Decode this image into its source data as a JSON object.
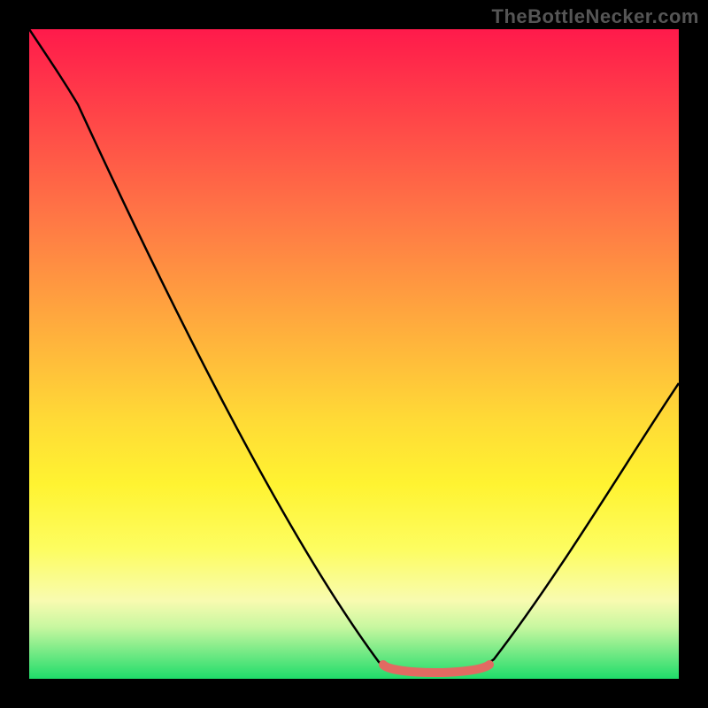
{
  "watermark": "TheBottleNecker.com",
  "colors": {
    "frame_bg": "#000000",
    "gradient_top": "#ff1a4b",
    "gradient_bottom": "#1fdc6a",
    "curve_stroke": "#000000",
    "marker_stroke": "#e26a62",
    "watermark_text": "#555555"
  },
  "chart_data": {
    "type": "line",
    "title": "",
    "xlabel": "",
    "ylabel": "",
    "xlim": [
      0,
      100
    ],
    "ylim": [
      0,
      100
    ],
    "grid": false,
    "legend": false,
    "x": [
      0,
      5,
      10,
      15,
      20,
      25,
      30,
      35,
      40,
      45,
      50,
      55,
      60,
      65,
      70,
      75,
      80,
      85,
      90,
      95,
      100
    ],
    "values": [
      100,
      92,
      86,
      78,
      70,
      62,
      54,
      46,
      38,
      29,
      20,
      10,
      4,
      1,
      1,
      4,
      12,
      22,
      32,
      40,
      46
    ],
    "highlight_region": {
      "x_start": 55,
      "x_end": 72,
      "note": "flat minimum band near bottom, drawn in muted red"
    },
    "description": "A single smooth V-shaped curve descending from the top-left corner to a broad minimum around x≈60–70 then rising toward the right edge, overlaid on a vertical rainbow heat gradient (red at top through yellow to green at bottom). No axes, ticks, or labels are rendered. A short red-orange thick stroke marks the flat bottom of the valley."
  }
}
